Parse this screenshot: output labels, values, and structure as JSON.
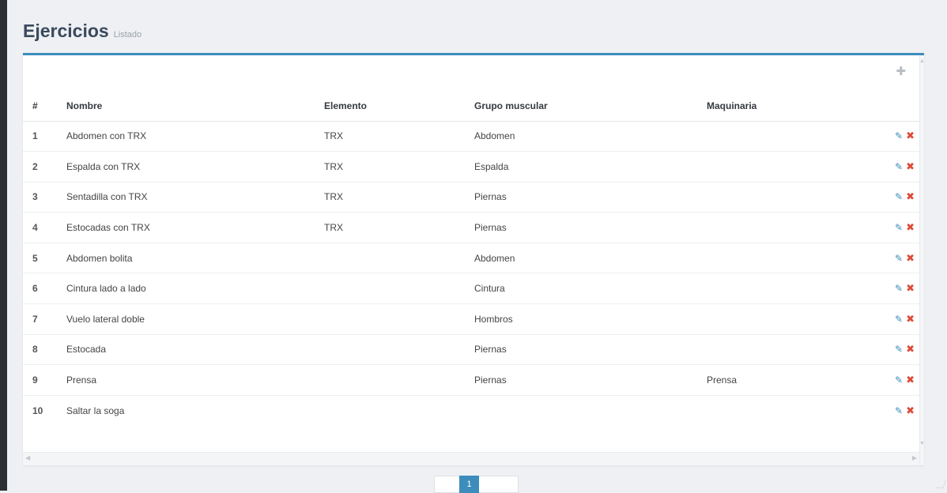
{
  "header": {
    "title": "Ejercicios",
    "subtitle": "Listado"
  },
  "icons": {
    "add": "plus-icon",
    "edit": "pencil-icon",
    "delete": "times-icon"
  },
  "colors": {
    "accent": "#3c8dbc",
    "delete": "#dd4b39"
  },
  "table": {
    "columns": [
      "#",
      "Nombre",
      "Elemento",
      "Grupo muscular",
      "Maquinaria"
    ],
    "rows": [
      {
        "num": "1",
        "nombre": "Abdomen con TRX",
        "elemento": "TRX",
        "grupo": "Abdomen",
        "maquinaria": ""
      },
      {
        "num": "2",
        "nombre": "Espalda con TRX",
        "elemento": "TRX",
        "grupo": "Espalda",
        "maquinaria": ""
      },
      {
        "num": "3",
        "nombre": "Sentadilla con TRX",
        "elemento": "TRX",
        "grupo": "Piernas",
        "maquinaria": ""
      },
      {
        "num": "4",
        "nombre": "Estocadas con TRX",
        "elemento": "TRX",
        "grupo": "Piernas",
        "maquinaria": ""
      },
      {
        "num": "5",
        "nombre": "Abdomen bolita",
        "elemento": "",
        "grupo": "Abdomen",
        "maquinaria": ""
      },
      {
        "num": "6",
        "nombre": "Cintura lado a lado",
        "elemento": "",
        "grupo": "Cintura",
        "maquinaria": ""
      },
      {
        "num": "7",
        "nombre": "Vuelo lateral doble",
        "elemento": "",
        "grupo": "Hombros",
        "maquinaria": ""
      },
      {
        "num": "8",
        "nombre": "Estocada",
        "elemento": "",
        "grupo": "Piernas",
        "maquinaria": ""
      },
      {
        "num": "9",
        "nombre": "Prensa",
        "elemento": "",
        "grupo": "Piernas",
        "maquinaria": "Prensa"
      },
      {
        "num": "10",
        "nombre": "Saltar la soga",
        "elemento": "",
        "grupo": "",
        "maquinaria": ""
      }
    ]
  },
  "pagination": {
    "current": "1",
    "prev_label": "",
    "next_label": ""
  }
}
